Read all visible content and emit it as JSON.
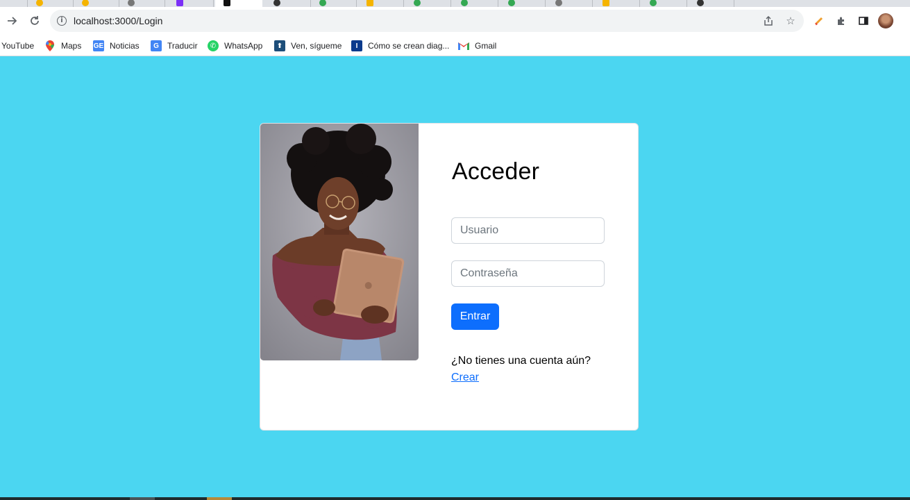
{
  "browser": {
    "url": "localhost:3000/Login",
    "bookmarks": [
      {
        "label": "YouTube",
        "icon": "youtube-icon"
      },
      {
        "label": "Maps",
        "icon": "maps-pin-icon"
      },
      {
        "label": "Noticias",
        "icon": "news-icon"
      },
      {
        "label": "Traducir",
        "icon": "translate-icon"
      },
      {
        "label": "WhatsApp",
        "icon": "whatsapp-icon"
      },
      {
        "label": "Ven, sígueme",
        "icon": "church-icon"
      },
      {
        "label": "Cómo se crean diag...",
        "icon": "bookmark-i-icon"
      },
      {
        "label": "Gmail",
        "icon": "gmail-icon"
      }
    ]
  },
  "login": {
    "title": "Acceder",
    "username_placeholder": "Usuario",
    "password_placeholder": "Contraseña",
    "submit_label": "Entrar",
    "no_account_text": "¿No tienes una cuenta aún?",
    "create_link": "Crear"
  },
  "colors": {
    "page_background": "#4bd6f1",
    "primary_button": "#0d6efd",
    "link": "#0d6efd"
  }
}
